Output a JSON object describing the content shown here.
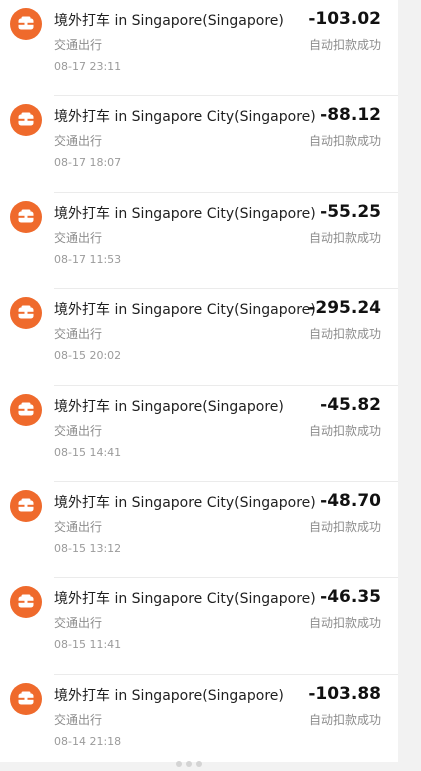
{
  "transactions": [
    {
      "title": "境外打车 in Singapore(Singapore)",
      "category": "交通出行",
      "time": "08-17 23:11",
      "amount": "-103.02",
      "status": "自动扣款成功",
      "icon": "ride-icon",
      "color": "#ef6a2c"
    },
    {
      "title": "境外打车 in Singapore City(Singapore)",
      "category": "交通出行",
      "time": "08-17 18:07",
      "amount": "-88.12",
      "status": "自动扣款成功",
      "icon": "ride-icon",
      "color": "#ef6a2c"
    },
    {
      "title": "境外打车 in Singapore City(Singapore)",
      "category": "交通出行",
      "time": "08-17 11:53",
      "amount": "-55.25",
      "status": "自动扣款成功",
      "icon": "ride-icon",
      "color": "#ef6a2c"
    },
    {
      "title": "境外打车 in Singapore City(Singapore)",
      "category": "交通出行",
      "time": "08-15 20:02",
      "amount": "-295.24",
      "status": "自动扣款成功",
      "icon": "ride-icon",
      "color": "#ef6a2c"
    },
    {
      "title": "境外打车 in Singapore(Singapore)",
      "category": "交通出行",
      "time": "08-15 14:41",
      "amount": "-45.82",
      "status": "自动扣款成功",
      "icon": "ride-icon",
      "color": "#ef6a2c"
    },
    {
      "title": "境外打车 in Singapore City(Singapore)",
      "category": "交通出行",
      "time": "08-15 13:12",
      "amount": "-48.70",
      "status": "自动扣款成功",
      "icon": "ride-icon",
      "color": "#ef6a2c"
    },
    {
      "title": "境外打车 in Singapore City(Singapore)",
      "category": "交通出行",
      "time": "08-15 11:41",
      "amount": "-46.35",
      "status": "自动扣款成功",
      "icon": "ride-icon",
      "color": "#ef6a2c"
    },
    {
      "title": "境外打车 in Singapore(Singapore)",
      "category": "交通出行",
      "time": "08-14 21:18",
      "amount": "-103.88",
      "status": "自动扣款成功",
      "icon": "ride-icon",
      "color": "#ef6a2c"
    }
  ]
}
